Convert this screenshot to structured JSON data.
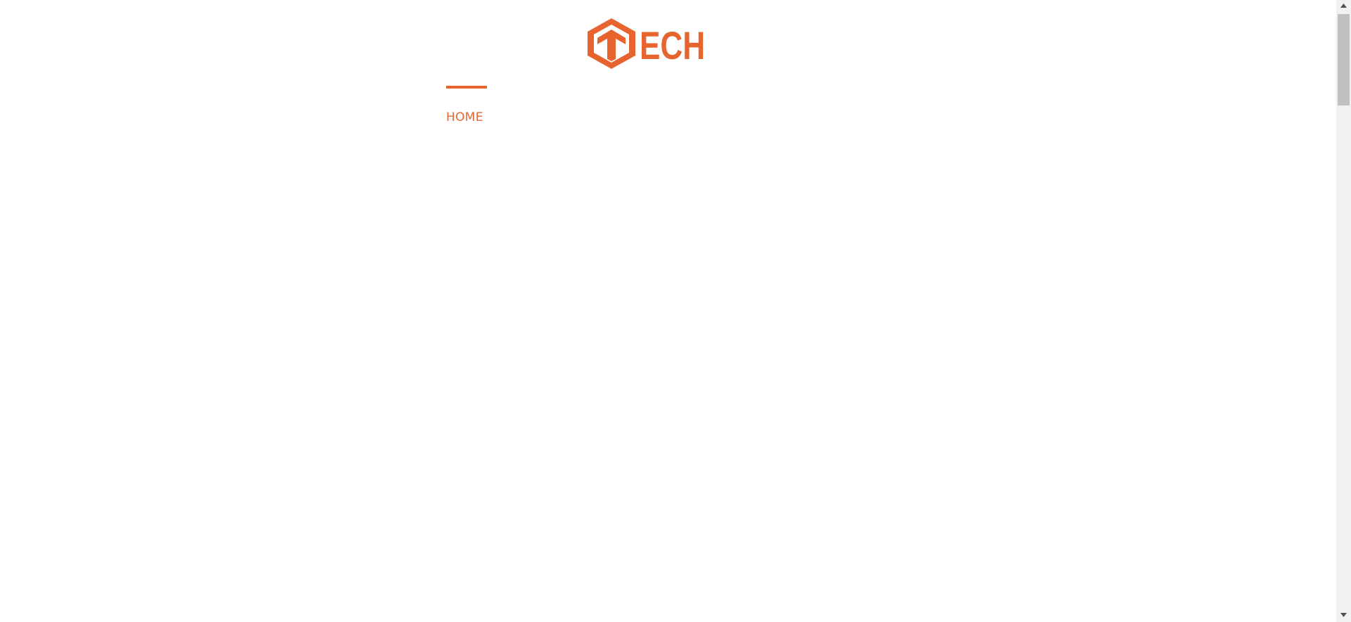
{
  "brand": {
    "logo_text": "ECH",
    "accent_color": "#e8642f"
  },
  "nav": {
    "items": [
      {
        "label": "HOME",
        "active": true
      }
    ]
  },
  "scrollbar": {
    "track_color": "#f1f1f1",
    "thumb_color": "#c1c1c1"
  }
}
